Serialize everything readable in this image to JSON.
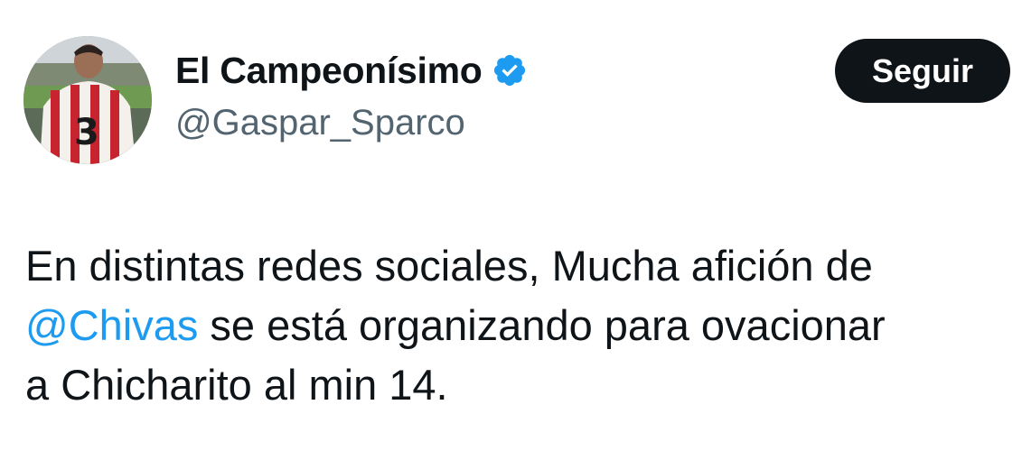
{
  "author": {
    "display_name": "El Campeonísimo",
    "handle": "@Gaspar_Sparco",
    "verified_icon": "verified-badge-icon",
    "avatar_icon": "profile-photo"
  },
  "actions": {
    "follow_label": "Seguir"
  },
  "tweet": {
    "line1": "En distintas redes sociales, Mucha afición de",
    "mention": "@Chivas",
    "line2_rest": " se está organizando para ovacionar",
    "line3": "a Chicharito al min 14."
  },
  "colors": {
    "text": "#0f1419",
    "secondary": "#536471",
    "link": "#1d9bf0",
    "button_bg": "#0f1419",
    "button_text": "#ffffff"
  }
}
